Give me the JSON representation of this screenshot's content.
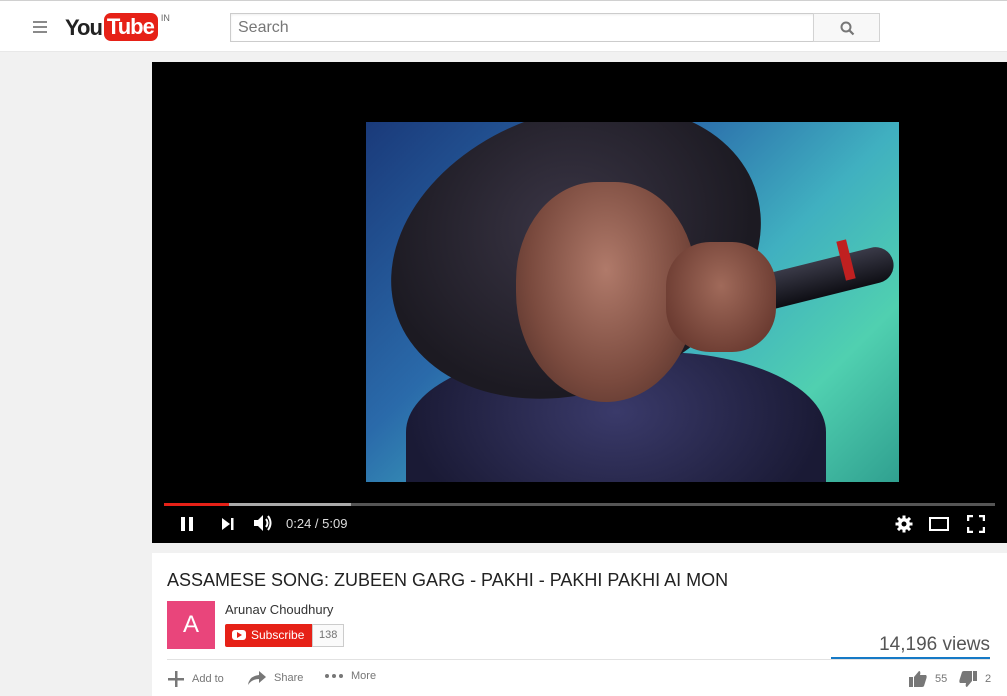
{
  "masthead": {
    "logo_you": "You",
    "logo_tube": "Tube",
    "country_code": "IN",
    "search_placeholder": "Search"
  },
  "player": {
    "current_time": "0:24",
    "duration": "5:09",
    "time_display": "0:24 / 5:09",
    "progress_played_fraction": 0.078,
    "progress_loaded_fraction": 0.225
  },
  "video": {
    "title": "ASSAMESE SONG: ZUBEEN GARG - PAKHI - PAKHI PAKHI AI MON",
    "channel": {
      "avatar_letter": "A",
      "name": "Arunav Choudhury",
      "subscribe_label": "Subscribe",
      "subscriber_count": "138"
    },
    "views": "14,196 views",
    "actions": {
      "add_to": "Add to",
      "share": "Share",
      "more": "More"
    },
    "likes": "55",
    "dislikes": "2"
  },
  "colors": {
    "brand_red": "#e62117",
    "avatar_pink": "#e9457b",
    "views_bar_blue": "#167ac6"
  }
}
